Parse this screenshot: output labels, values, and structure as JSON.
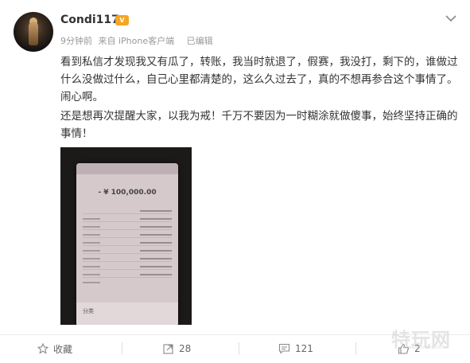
{
  "post": {
    "username": "Condi117",
    "meta": {
      "time": "9分钟前",
      "source": "来自 iPhone客户端",
      "edited": "已编辑"
    },
    "paragraphs": [
      "看到私信才发现我又有瓜了，转账，我当时就退了，假赛，我没打，剩下的，谁做过什么没做过什么，自己心里都清楚的，这么久过去了，真的不想再参合这个事情了。闹心啊。",
      "还是想再次提醒大家，以我为戒！千万不要因为一时糊涂就做傻事，始终坚持正确的事情！"
    ],
    "image": {
      "amount": "- ¥ 100,000.00",
      "section": "分类"
    }
  },
  "actions": {
    "favorite_label": "收藏",
    "forward_count": "28",
    "comment_count": "121",
    "like_count": "2"
  },
  "watermark": {
    "text": "特玩网",
    "url": "www.tevvan.com"
  },
  "colors": {
    "badge": "#f5a623",
    "text": "#333333",
    "meta": "#999999"
  }
}
